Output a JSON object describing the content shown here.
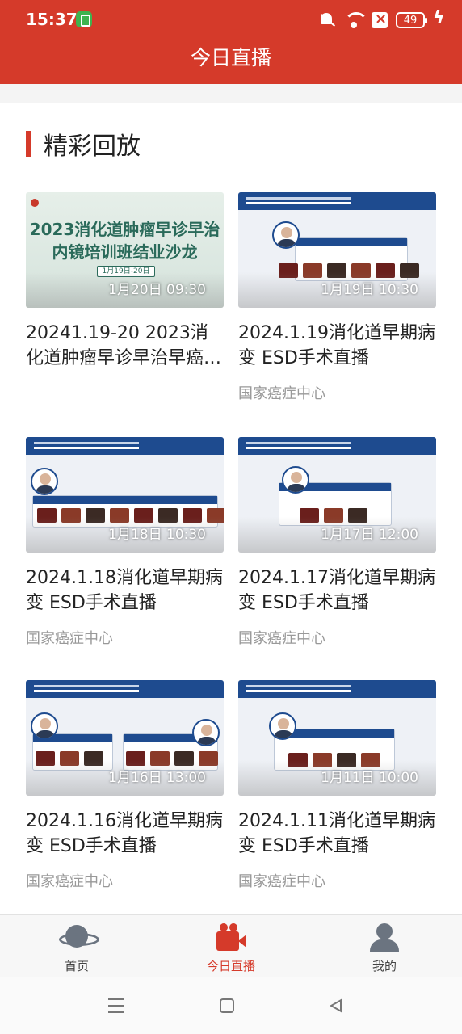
{
  "status_bar": {
    "time": "15:37",
    "battery": "49"
  },
  "header": {
    "title": "今日直播"
  },
  "section": {
    "title": "精彩回放"
  },
  "cards": [
    {
      "thumb_line1": "2023消化道肿瘤早诊早治",
      "thumb_line2": "内镜培训班结业沙龙",
      "thumb_tag": "1月19日-20日",
      "date": "1月20日 09:30",
      "title": "20241.19-20 2023消化道肿瘤早诊早治早癌…",
      "source": ""
    },
    {
      "date": "1月19日 10:30",
      "title": "2024.1.19消化道早期病变 ESD手术直播",
      "source": "国家癌症中心"
    },
    {
      "date": "1月18日 10:30",
      "title": "2024.1.18消化道早期病变 ESD手术直播",
      "source": "国家癌症中心"
    },
    {
      "date": "1月17日 12:00",
      "title": "2024.1.17消化道早期病变 ESD手术直播",
      "source": "国家癌症中心"
    },
    {
      "date": "1月16日 13:00",
      "title": "2024.1.16消化道早期病变 ESD手术直播",
      "source": "国家癌症中心"
    },
    {
      "date": "1月11日 10:00",
      "title": "2024.1.11消化道早期病变 ESD手术直播",
      "source": "国家癌症中心"
    }
  ],
  "bottom_nav": {
    "home": "首页",
    "live": "今日直播",
    "mine": "我的"
  },
  "colors": {
    "accent": "#d53a2a",
    "thumb_blue": "#1e4b8f"
  },
  "icons": [
    "bell-muted-icon",
    "wifi-icon",
    "sim-icon",
    "battery-icon",
    "charging-icon",
    "planet-icon",
    "video-camera-icon",
    "user-icon",
    "menu-icon",
    "home-square-icon",
    "back-icon"
  ]
}
